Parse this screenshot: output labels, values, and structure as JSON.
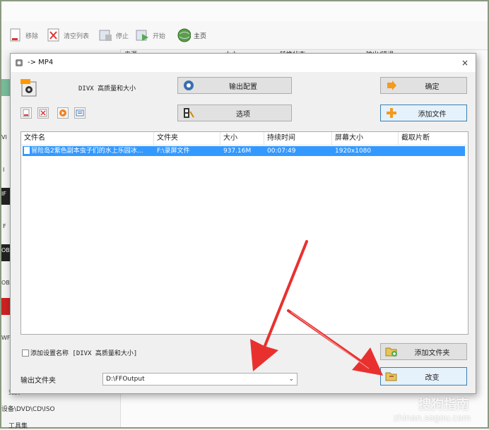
{
  "background": {
    "toolbar": {
      "remove": "移除",
      "clear_list": "清空列表",
      "stop": "停止",
      "start": "开始",
      "home": "主页"
    },
    "sidebar": {
      "items": [
        "VI",
        "I",
        "IF",
        "F",
        "OB",
        "OB",
        "WF"
      ],
      "bottom_items": [
        "设备\\DVD\\CD\\ISO",
        "工具集"
      ],
      "partial_top": "变换"
    },
    "right_columns": [
      "来源",
      "大小",
      "转换状态",
      "输出/错误"
    ]
  },
  "dialog": {
    "title": "-> MP4",
    "close": "×",
    "preset_name": "DIVX 高质量和大小",
    "buttons": {
      "output_config": "输出配置",
      "options": "选项",
      "ok": "确定",
      "add_file": "添加文件",
      "add_folder": "添加文件夹",
      "change": "改变"
    },
    "table": {
      "headers": [
        "文件名",
        "文件夹",
        "大小",
        "持续时间",
        "屏幕大小",
        "截取片断"
      ],
      "rows": [
        {
          "name": "冒险岛2紫色副本虫子们的水上乐园冰…",
          "folder": "F:\\录屏文件",
          "size": "937.16M",
          "duration": "00:07:49",
          "screen": "1920x1080",
          "clip": ""
        }
      ]
    },
    "add_preset_label": "添加设置名称 [DIVX 高质量和大小]",
    "output_folder_label": "输出文件夹",
    "output_folder_value": "D:\\FFOutput"
  },
  "watermark": {
    "line1": "搜狗指南",
    "line2": "zhinan.sogou.com"
  },
  "colors": {
    "selection": "#3399ff",
    "arrow": "#e8312f",
    "frame": "#8a9a80"
  }
}
